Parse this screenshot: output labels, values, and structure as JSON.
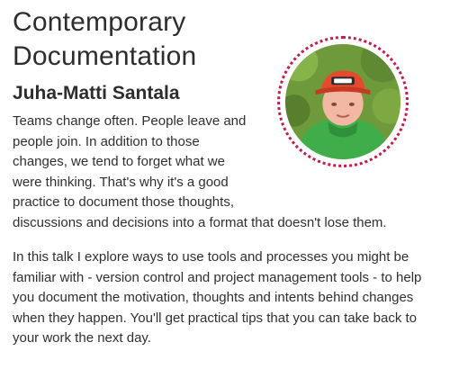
{
  "talk": {
    "title_line_1": "Contemporary",
    "title_line_2": "Documentation",
    "speaker": "Juha-Matti Santala",
    "abstract_paragraph_1": "Teams change often. People leave and people join. In addition to those changes, we tend to forget what we were thinking. That's why it's a good practice to document those thoughts, discussions and decisions into a format that doesn't lose them.",
    "abstract_paragraph_2": "In this talk I explore ways to use tools and processes you might be familiar with - version control and project management tools - to help you document the motivation, thoughts and intents behind changes when they happen. You'll get practical tips that you can take back to your work the next day."
  },
  "colors": {
    "text": "#2f2f2f",
    "avatar_border": "#c61a4a",
    "cap": "#e64a2e",
    "hoodie": "#3fae4a"
  },
  "icons": {
    "avatar": "speaker-photo"
  }
}
